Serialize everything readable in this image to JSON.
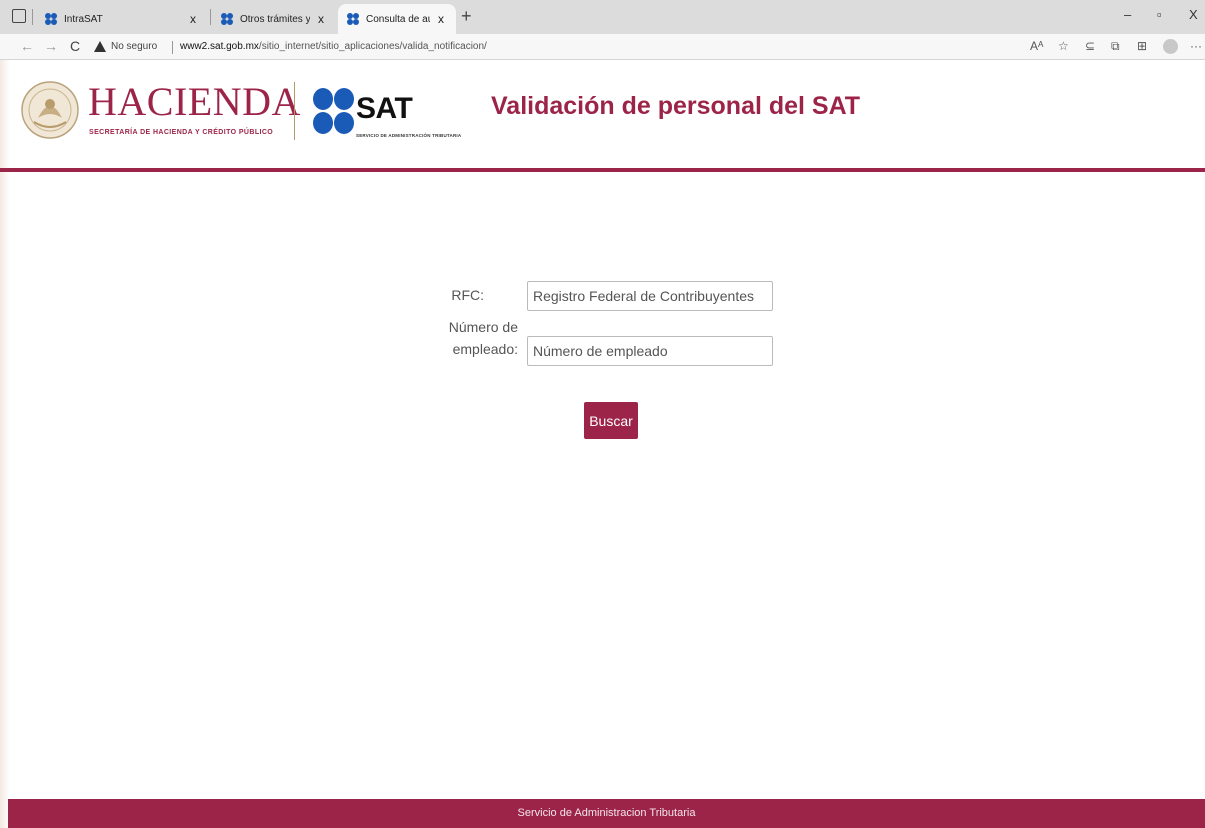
{
  "browser": {
    "tabs": [
      {
        "title": "IntraSAT",
        "close": "x",
        "active": false
      },
      {
        "title": "Otros trámites y servicios - Porta",
        "close": "x",
        "active": false
      },
      {
        "title": "Consulta de autenticidad",
        "close": "x",
        "active": true
      }
    ],
    "new_tab": "+",
    "window": {
      "minimize": "–",
      "restore": "▫",
      "close": "X"
    },
    "nav": {
      "back": "←",
      "forward": "→",
      "reload": "C"
    },
    "security_label": "No seguro",
    "url_domain": "www2.sat.gob.mx",
    "url_path": "/sitio_internet/sitio_aplicaciones/valida_notificacion/",
    "toolbar_icons": [
      "Aᴬ",
      "☆",
      "⊆",
      "⧉",
      "⊞",
      "···"
    ]
  },
  "header": {
    "hacienda": "HACIENDA",
    "hacienda_sub": "SECRETARÍA DE HACIENDA Y CRÉDITO PÚBLICO",
    "sat": "SAT",
    "sat_sub": "SERVICIO DE ADMINISTRACIÓN TRIBUTARIA",
    "title": "Validación de personal del SAT"
  },
  "form": {
    "rfc_label": "RFC:",
    "rfc_placeholder": "Registro Federal de Contribuyentes",
    "rfc_value": "",
    "employee_label_line1": "Número de",
    "employee_label_line2": "empleado:",
    "employee_placeholder": "Número de empleado",
    "employee_value": "",
    "submit": "Buscar"
  },
  "footer": {
    "text": "Servicio de Administracion Tributaria"
  },
  "colors": {
    "brand": "#9d2449",
    "sat_blue": "#1a5bb8"
  }
}
